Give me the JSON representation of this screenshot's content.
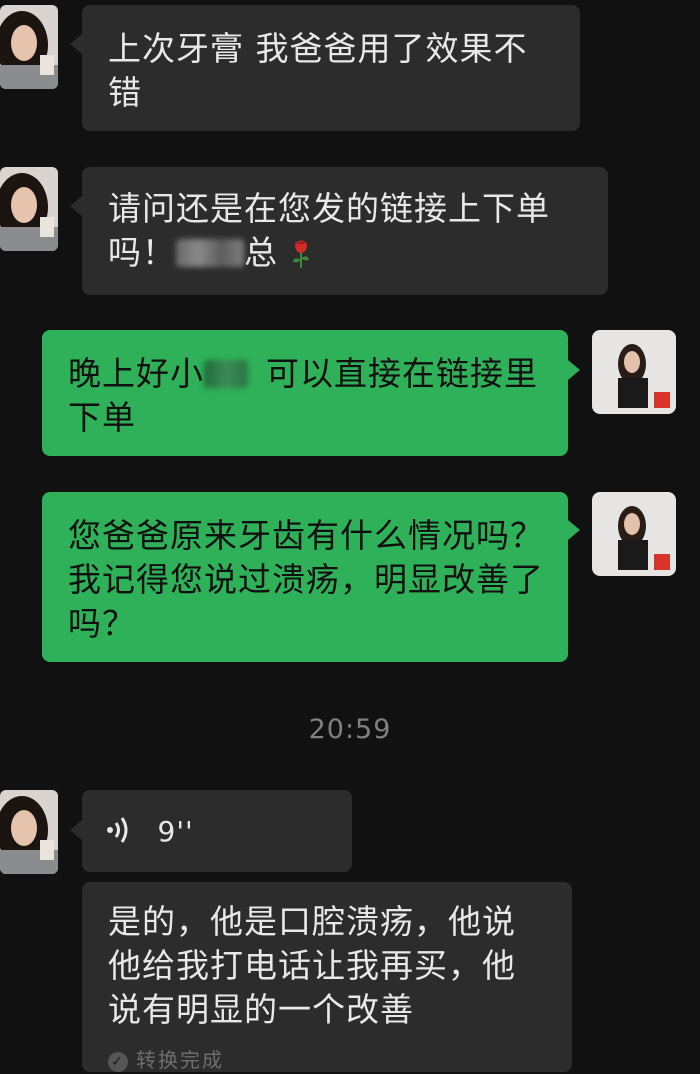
{
  "messages": [
    {
      "direction": "in",
      "text": "上次牙膏 我爸爸用了效果不错"
    },
    {
      "direction": "in",
      "text_before": "请问还是在您发的链接上下单吗！",
      "text_after": "总",
      "emoji": "rose-icon"
    },
    {
      "direction": "out",
      "text_before": "晚上好小",
      "text_after": "可以直接在链接里下单"
    },
    {
      "direction": "out",
      "text": "您爸爸原来牙齿有什么情况吗？我记得您说过溃疡，明显改善了吗？"
    }
  ],
  "timestamp": "20:59",
  "voice": {
    "duration": "9''",
    "icon": "voice-wave-icon"
  },
  "transcription": {
    "text": "是的，他是口腔溃疡，他说他给我打电话让我再买，他说有明显的一个改善",
    "status": "转换完成"
  },
  "colors": {
    "incoming_bubble": "#2c2c2c",
    "outgoing_bubble": "#2eb159",
    "background": "#111111"
  }
}
